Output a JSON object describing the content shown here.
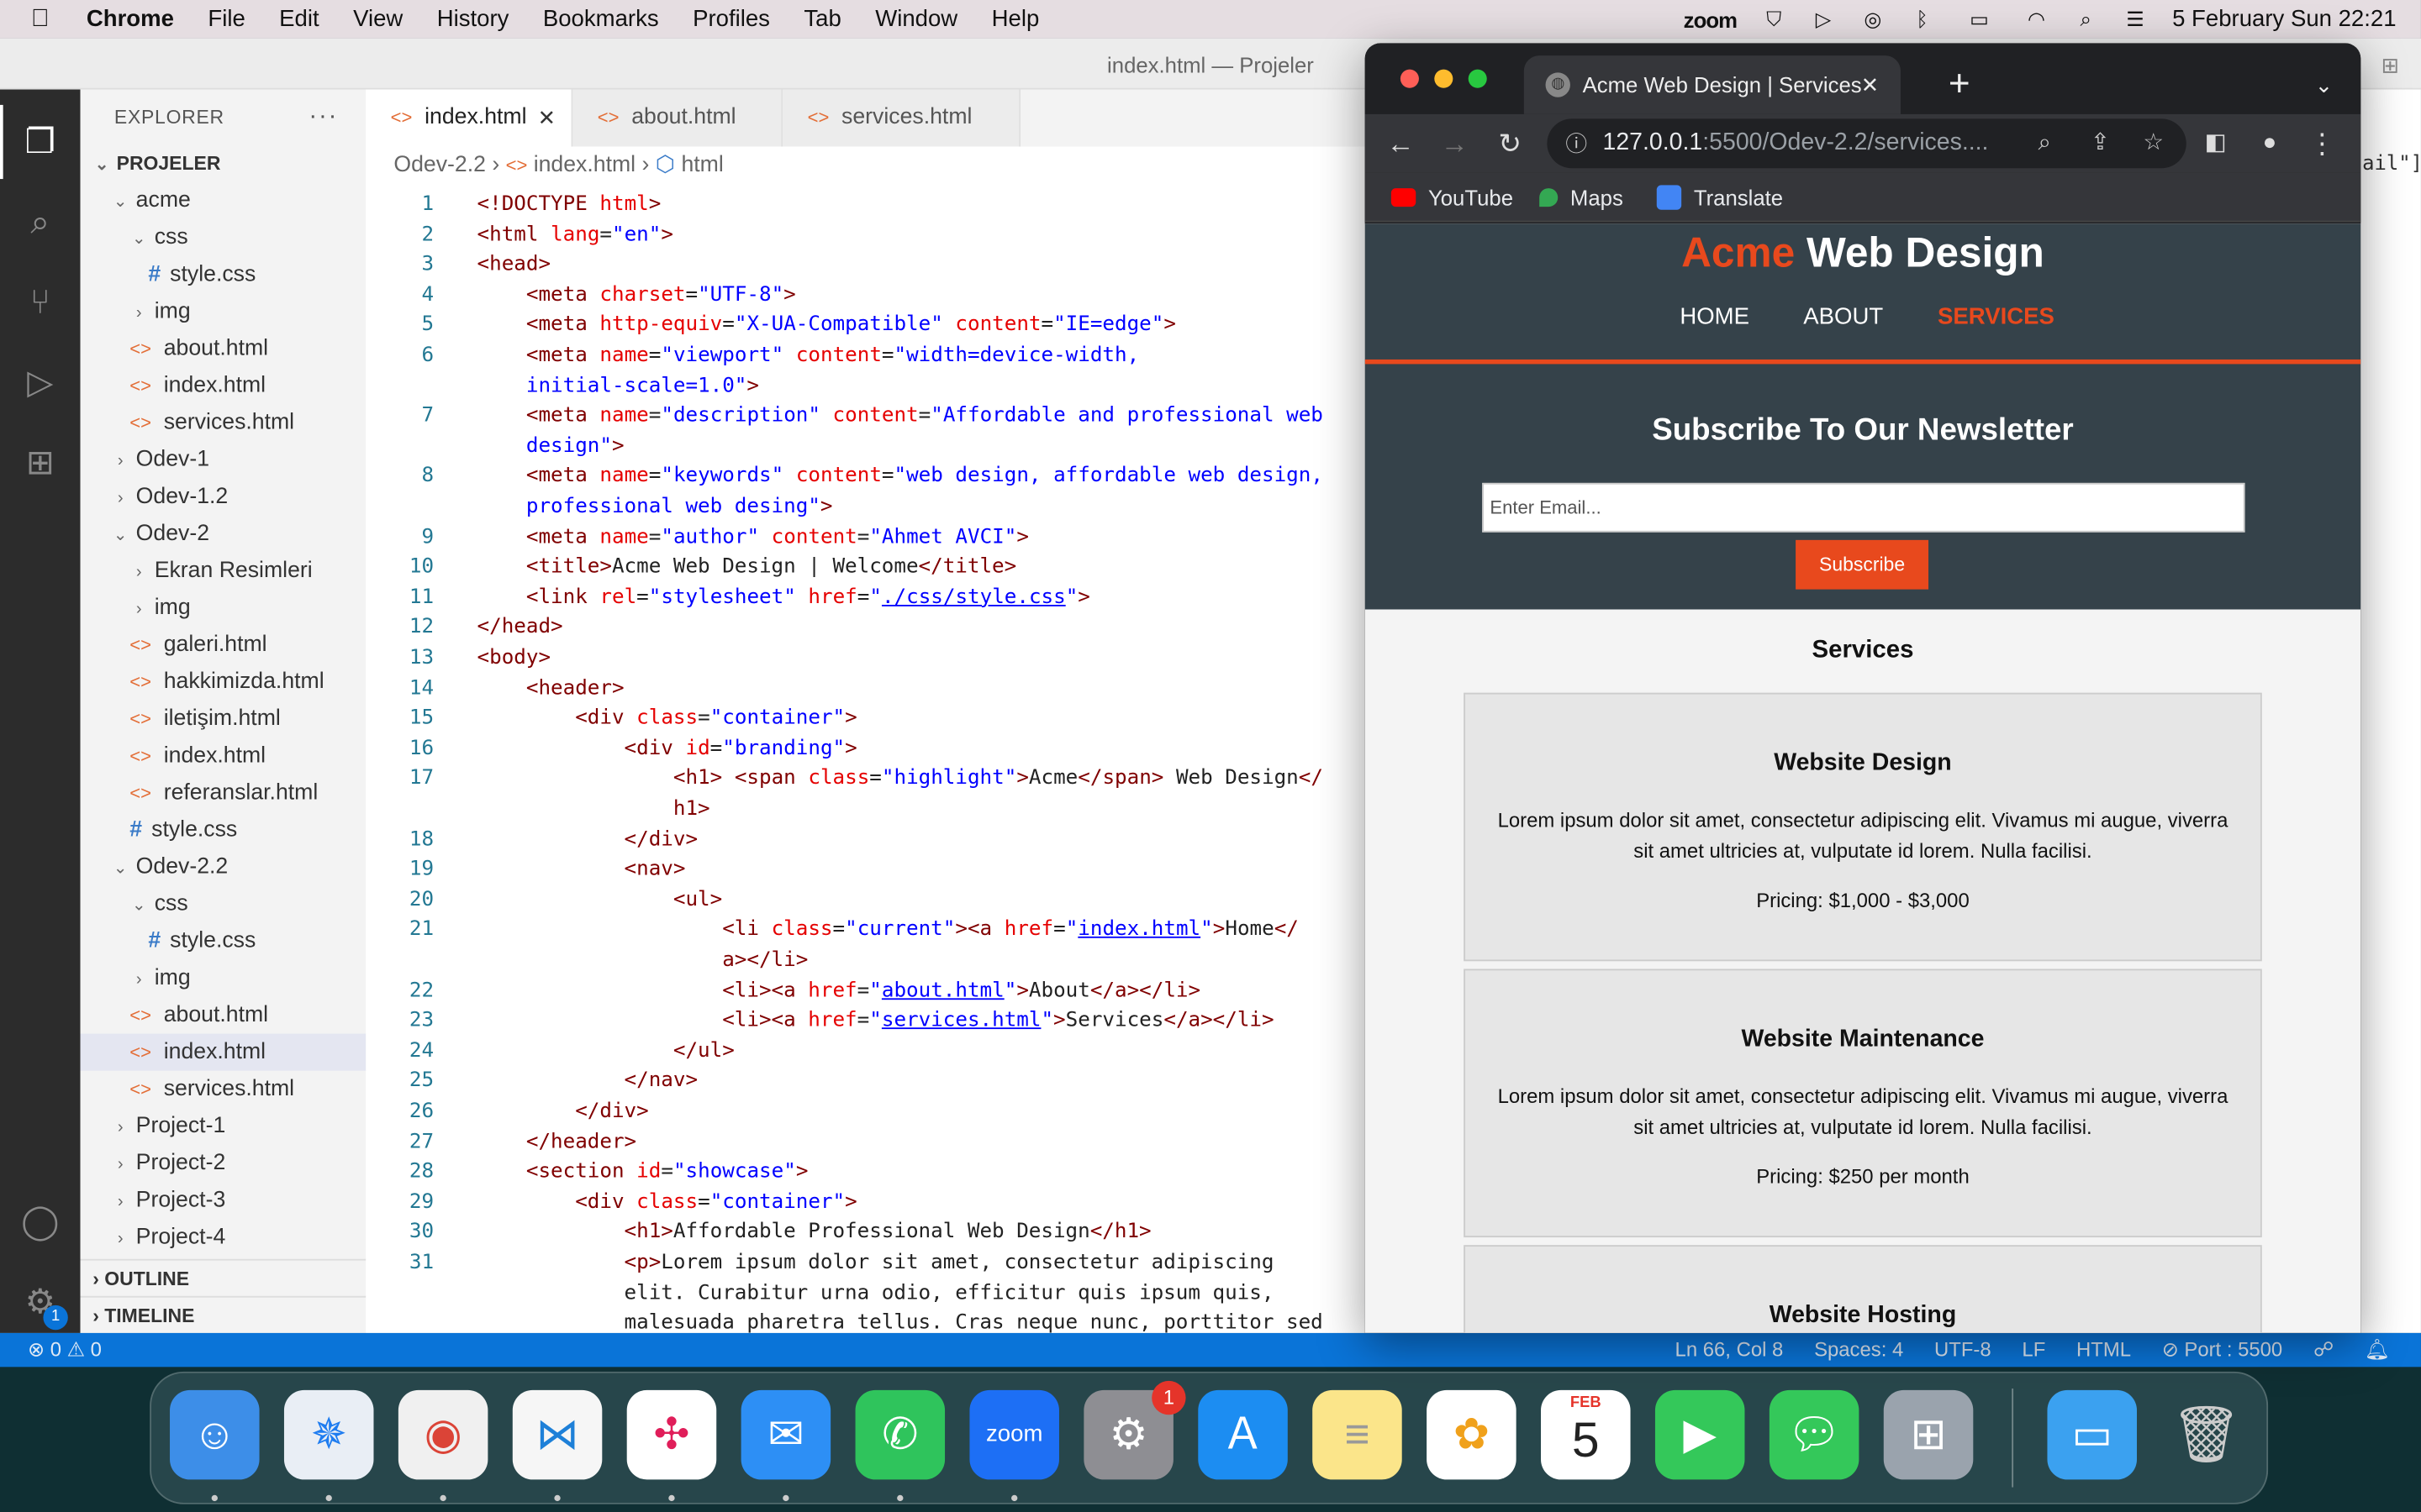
{
  "menubar": {
    "app": "Chrome",
    "items": [
      "File",
      "Edit",
      "View",
      "History",
      "Bookmarks",
      "Profiles",
      "Tab",
      "Window",
      "Help"
    ],
    "zoom": "zoom",
    "datetime": "5 February Sun  22:21"
  },
  "vscode": {
    "title": "index.html — Projeler",
    "explorer_label": "EXPLORER",
    "tree": [
      {
        "label": "PROJELER",
        "indent": 0,
        "kind": "root",
        "chev": "⌄"
      },
      {
        "label": "acme",
        "indent": 1,
        "kind": "folder",
        "chev": "⌄"
      },
      {
        "label": "css",
        "indent": 2,
        "kind": "folder",
        "chev": "⌄"
      },
      {
        "label": "style.css",
        "indent": 3,
        "kind": "css"
      },
      {
        "label": "img",
        "indent": 2,
        "kind": "folder",
        "chev": "›"
      },
      {
        "label": "about.html",
        "indent": 2,
        "kind": "html"
      },
      {
        "label": "index.html",
        "indent": 2,
        "kind": "html"
      },
      {
        "label": "services.html",
        "indent": 2,
        "kind": "html"
      },
      {
        "label": "Odev-1",
        "indent": 1,
        "kind": "folder",
        "chev": "›"
      },
      {
        "label": "Odev-1.2",
        "indent": 1,
        "kind": "folder",
        "chev": "›"
      },
      {
        "label": "Odev-2",
        "indent": 1,
        "kind": "folder",
        "chev": "⌄"
      },
      {
        "label": "Ekran Resimleri",
        "indent": 2,
        "kind": "folder",
        "chev": "›"
      },
      {
        "label": "img",
        "indent": 2,
        "kind": "folder",
        "chev": "›"
      },
      {
        "label": "galeri.html",
        "indent": 2,
        "kind": "html"
      },
      {
        "label": "hakkimizda.html",
        "indent": 2,
        "kind": "html"
      },
      {
        "label": "iletişim.html",
        "indent": 2,
        "kind": "html"
      },
      {
        "label": "index.html",
        "indent": 2,
        "kind": "html"
      },
      {
        "label": "referanslar.html",
        "indent": 2,
        "kind": "html"
      },
      {
        "label": "style.css",
        "indent": 2,
        "kind": "css"
      },
      {
        "label": "Odev-2.2",
        "indent": 1,
        "kind": "folder",
        "chev": "⌄"
      },
      {
        "label": "css",
        "indent": 2,
        "kind": "folder",
        "chev": "⌄"
      },
      {
        "label": "style.css",
        "indent": 3,
        "kind": "css"
      },
      {
        "label": "img",
        "indent": 2,
        "kind": "folder",
        "chev": "›"
      },
      {
        "label": "about.html",
        "indent": 2,
        "kind": "html"
      },
      {
        "label": "index.html",
        "indent": 2,
        "kind": "html",
        "selected": true
      },
      {
        "label": "services.html",
        "indent": 2,
        "kind": "html"
      },
      {
        "label": "Project-1",
        "indent": 1,
        "kind": "folder",
        "chev": "›"
      },
      {
        "label": "Project-2",
        "indent": 1,
        "kind": "folder",
        "chev": "›"
      },
      {
        "label": "Project-3",
        "indent": 1,
        "kind": "folder",
        "chev": "›"
      },
      {
        "label": "Project-4",
        "indent": 1,
        "kind": "folder",
        "chev": "›"
      }
    ],
    "outline": "OUTLINE",
    "timeline": "TIMELINE",
    "tabs": [
      "index.html",
      "about.html",
      "services.html"
    ],
    "breadcrumb": {
      "folder": "Odev-2.2",
      "file": "index.html",
      "symbol": "html"
    },
    "code_lines": [
      {
        "n": "1",
        "html": "<span class='t'>&lt;!DOCTYPE</span> <span class='a'>html</span><span class='t'>&gt;</span>"
      },
      {
        "n": "2",
        "html": "<span class='t'>&lt;html</span> <span class='a'>lang</span>=<span class='s'>\"en\"</span><span class='t'>&gt;</span>"
      },
      {
        "n": "3",
        "html": "<span class='t'>&lt;head&gt;</span>"
      },
      {
        "n": "4",
        "html": "    <span class='t'>&lt;meta</span> <span class='a'>charset</span>=<span class='s'>\"UTF-8\"</span><span class='t'>&gt;</span>"
      },
      {
        "n": "5",
        "html": "    <span class='t'>&lt;meta</span> <span class='a'>http-equiv</span>=<span class='s'>\"X-UA-Compatible\"</span> <span class='a'>content</span>=<span class='s'>\"IE=edge\"</span><span class='t'>&gt;</span>"
      },
      {
        "n": "6",
        "html": "    <span class='t'>&lt;meta</span> <span class='a'>name</span>=<span class='s'>\"viewport\"</span> <span class='a'>content</span>=<span class='s'>\"width=device-width,</span>"
      },
      {
        "n": "",
        "html": "    <span class='s'>initial-scale=1.0\"</span><span class='t'>&gt;</span>"
      },
      {
        "n": "7",
        "html": "    <span class='t'>&lt;meta</span> <span class='a'>name</span>=<span class='s'>\"description\"</span> <span class='a'>content</span>=<span class='s'>\"Affordable and professional web</span>"
      },
      {
        "n": "",
        "html": "    <span class='s'>design\"</span><span class='t'>&gt;</span>"
      },
      {
        "n": "8",
        "html": "    <span class='t'>&lt;meta</span> <span class='a'>name</span>=<span class='s'>\"keywords\"</span> <span class='a'>content</span>=<span class='s'>\"web design, affordable web design,</span>"
      },
      {
        "n": "",
        "html": "    <span class='s'>professional web desing\"</span><span class='t'>&gt;</span>"
      },
      {
        "n": "9",
        "html": "    <span class='t'>&lt;meta</span> <span class='a'>name</span>=<span class='s'>\"author\"</span> <span class='a'>content</span>=<span class='s'>\"Ahmet AVCI\"</span><span class='t'>&gt;</span>"
      },
      {
        "n": "10",
        "html": "    <span class='t'>&lt;title&gt;</span>Acme Web Design | Welcome<span class='t'>&lt;/title&gt;</span>"
      },
      {
        "n": "11",
        "html": "    <span class='t'>&lt;link</span> <span class='a'>rel</span>=<span class='s'>\"stylesheet\"</span> <span class='a'>href</span>=<span class='s'>\"</span><span class='u'>./css/style.css</span><span class='s'>\"</span><span class='t'>&gt;</span>"
      },
      {
        "n": "12",
        "html": "<span class='t'>&lt;/head&gt;</span>"
      },
      {
        "n": "13",
        "html": "<span class='t'>&lt;body&gt;</span>"
      },
      {
        "n": "14",
        "html": "    <span class='t'>&lt;header&gt;</span>"
      },
      {
        "n": "15",
        "html": "        <span class='t'>&lt;div</span> <span class='a'>class</span>=<span class='s'>\"container\"</span><span class='t'>&gt;</span>"
      },
      {
        "n": "16",
        "html": "            <span class='t'>&lt;div</span> <span class='a'>id</span>=<span class='s'>\"branding\"</span><span class='t'>&gt;</span>"
      },
      {
        "n": "17",
        "html": "                <span class='t'>&lt;h1&gt;</span> <span class='t'>&lt;span</span> <span class='a'>class</span>=<span class='s'>\"highlight\"</span><span class='t'>&gt;</span>Acme<span class='t'>&lt;/span&gt;</span> Web Design<span class='t'>&lt;/</span>"
      },
      {
        "n": "",
        "html": "                <span class='t'>h1&gt;</span>"
      },
      {
        "n": "18",
        "html": "            <span class='t'>&lt;/div&gt;</span>"
      },
      {
        "n": "19",
        "html": "            <span class='t'>&lt;nav&gt;</span>"
      },
      {
        "n": "20",
        "html": "                <span class='t'>&lt;ul&gt;</span>"
      },
      {
        "n": "21",
        "html": "                    <span class='t'>&lt;li</span> <span class='a'>class</span>=<span class='s'>\"current\"</span><span class='t'>&gt;&lt;a</span> <span class='a'>href</span>=<span class='s'>\"</span><span class='u'>index.html</span><span class='s'>\"</span><span class='t'>&gt;</span>Home<span class='t'>&lt;/</span>"
      },
      {
        "n": "",
        "html": "                    <span class='t'>a&gt;&lt;/li&gt;</span>"
      },
      {
        "n": "22",
        "html": "                    <span class='t'>&lt;li&gt;&lt;a</span> <span class='a'>href</span>=<span class='s'>\"</span><span class='u'>about.html</span><span class='s'>\"</span><span class='t'>&gt;</span>About<span class='t'>&lt;/a&gt;&lt;/li&gt;</span>"
      },
      {
        "n": "23",
        "html": "                    <span class='t'>&lt;li&gt;&lt;a</span> <span class='a'>href</span>=<span class='s'>\"</span><span class='u'>services.html</span><span class='s'>\"</span><span class='t'>&gt;</span>Services<span class='t'>&lt;/a&gt;&lt;/li&gt;</span>"
      },
      {
        "n": "24",
        "html": "                <span class='t'>&lt;/ul&gt;</span>"
      },
      {
        "n": "25",
        "html": "            <span class='t'>&lt;/nav&gt;</span>"
      },
      {
        "n": "26",
        "html": "        <span class='t'>&lt;/div&gt;</span>"
      },
      {
        "n": "27",
        "html": "    <span class='t'>&lt;/header&gt;</span>"
      },
      {
        "n": "28",
        "html": "    <span class='t'>&lt;section</span> <span class='a'>id</span>=<span class='s'>\"showcase\"</span><span class='t'>&gt;</span>"
      },
      {
        "n": "29",
        "html": "        <span class='t'>&lt;div</span> <span class='a'>class</span>=<span class='s'>\"container\"</span><span class='t'>&gt;</span>"
      },
      {
        "n": "30",
        "html": "            <span class='t'>&lt;h1&gt;</span>Affordable Professional Web Design<span class='t'>&lt;/h1&gt;</span>"
      },
      {
        "n": "31",
        "html": "            <span class='t'>&lt;p&gt;</span>Lorem ipsum dolor sit amet, consectetur adipiscing"
      },
      {
        "n": "",
        "html": "            elit. Curabitur urna odio, efficitur quis ipsum quis,"
      },
      {
        "n": "",
        "html": "            malesuada pharetra tellus. Cras neque nunc, porttitor sed"
      }
    ],
    "status": {
      "problems": "⊗ 0 ⚠ 0",
      "position": "Ln 66, Col 8",
      "spaces": "Spaces: 4",
      "encoding": "UTF-8",
      "eol": "LF",
      "language": "HTML",
      "port": "⊘ Port : 5500"
    },
    "right_edge_text": "ail\"]"
  },
  "chrome": {
    "tab_title": "Acme Web Design | Services",
    "url_host": "127.0.0.1",
    "url_rest": ":5500/Odev-2.2/services....",
    "bookmarks": [
      "YouTube",
      "Maps",
      "Translate"
    ],
    "page": {
      "brand_highlight": "Acme",
      "brand_rest": " Web Design",
      "nav": [
        "HOME",
        "ABOUT",
        "SERVICES"
      ],
      "newsletter_title": "Subscribe To Our Newsletter",
      "email_placeholder": "Enter Email...",
      "subscribe_label": "Subscribe",
      "services_title": "Services",
      "cards": [
        {
          "title": "Website Design",
          "text": "Lorem ipsum dolor sit amet, consectetur adipiscing elit. Vivamus mi augue, viverra sit amet ultricies at, vulputate id lorem. Nulla facilisi.",
          "price": "Pricing: $1,000 - $3,000"
        },
        {
          "title": "Website Maintenance",
          "text": "Lorem ipsum dolor sit amet, consectetur adipiscing elit. Vivamus mi augue, viverra sit amet ultricies at, vulputate id lorem. Nulla facilisi.",
          "price": "Pricing: $250 per month"
        },
        {
          "title": "Website Hosting",
          "text": "",
          "price": ""
        }
      ]
    }
  },
  "dock": {
    "calendar_month": "FEB",
    "calendar_day": "5",
    "settings_badge": "1",
    "zoom_label": "zoom"
  }
}
